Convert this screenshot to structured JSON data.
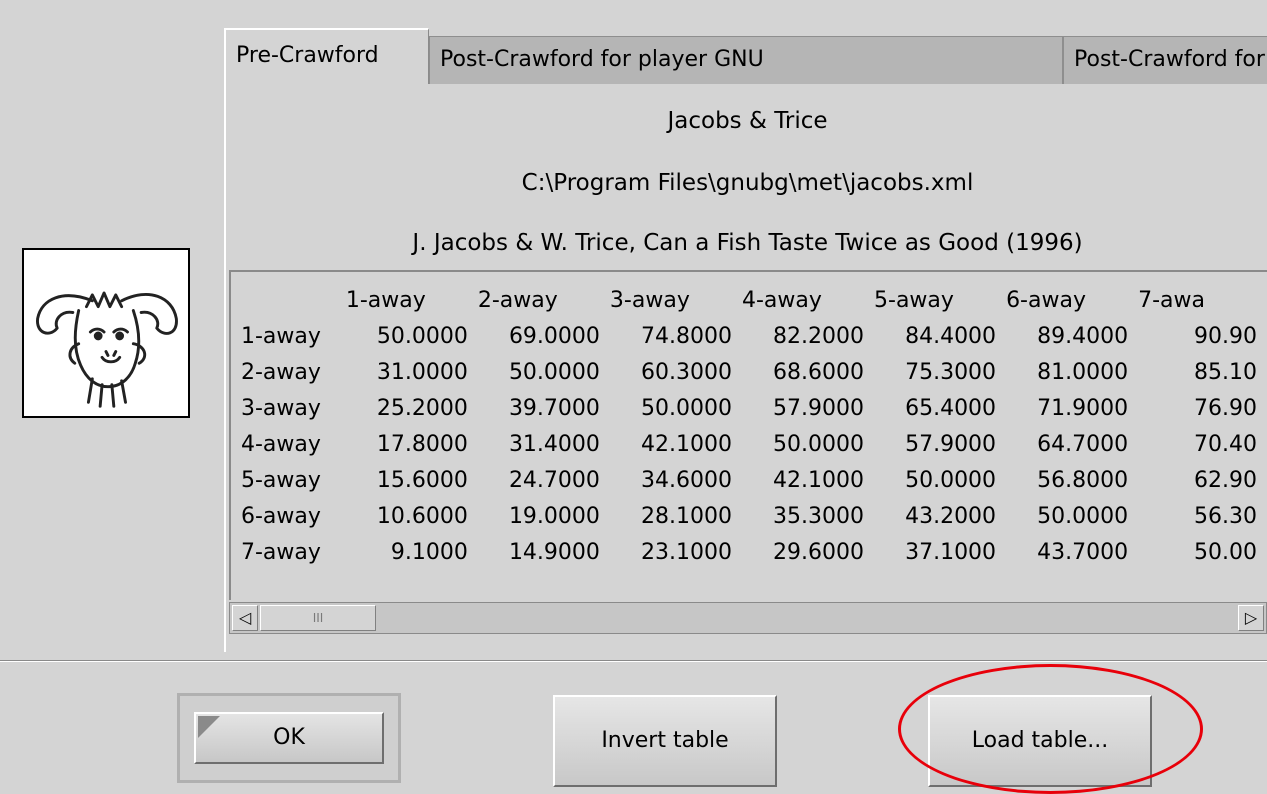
{
  "tabs": [
    {
      "label": "Pre-Crawford"
    },
    {
      "label": "Post-Crawford for player GNU"
    },
    {
      "label": "Post-Crawford for player Albert"
    }
  ],
  "met": {
    "name": "Jacobs & Trice",
    "file": "C:\\Program Files\\gnubg\\met\\jacobs.xml",
    "description": "J. Jacobs & W. Trice, Can a Fish Taste Twice as Good (1996)"
  },
  "table": {
    "columns": [
      "1-away",
      "2-away",
      "3-away",
      "4-away",
      "5-away",
      "6-away",
      "7-awa"
    ],
    "rows": [
      {
        "label": "1-away",
        "values": [
          "50.0000",
          "69.0000",
          "74.8000",
          "82.2000",
          "84.4000",
          "89.4000",
          "90.90"
        ]
      },
      {
        "label": "2-away",
        "values": [
          "31.0000",
          "50.0000",
          "60.3000",
          "68.6000",
          "75.3000",
          "81.0000",
          "85.10"
        ]
      },
      {
        "label": "3-away",
        "values": [
          "25.2000",
          "39.7000",
          "50.0000",
          "57.9000",
          "65.4000",
          "71.9000",
          "76.90"
        ]
      },
      {
        "label": "4-away",
        "values": [
          "17.8000",
          "31.4000",
          "42.1000",
          "50.0000",
          "57.9000",
          "64.7000",
          "70.40"
        ]
      },
      {
        "label": "5-away",
        "values": [
          "15.6000",
          "24.7000",
          "34.6000",
          "42.1000",
          "50.0000",
          "56.8000",
          "62.90"
        ]
      },
      {
        "label": "6-away",
        "values": [
          "10.6000",
          "19.0000",
          "28.1000",
          "35.3000",
          "43.2000",
          "50.0000",
          "56.30"
        ]
      },
      {
        "label": "7-away",
        "values": [
          "9.1000",
          "14.9000",
          "23.1000",
          "29.6000",
          "37.1000",
          "43.7000",
          "50.00"
        ]
      }
    ]
  },
  "scrollbar": {
    "left_arrow": "◁",
    "right_arrow": "▷",
    "thumb_grip": "III"
  },
  "buttons": {
    "ok": "OK",
    "invert": "Invert table",
    "load": "Load table..."
  },
  "icons": {
    "logo": "gnu-head-icon"
  },
  "colors": {
    "highlight": "#e8000a"
  }
}
